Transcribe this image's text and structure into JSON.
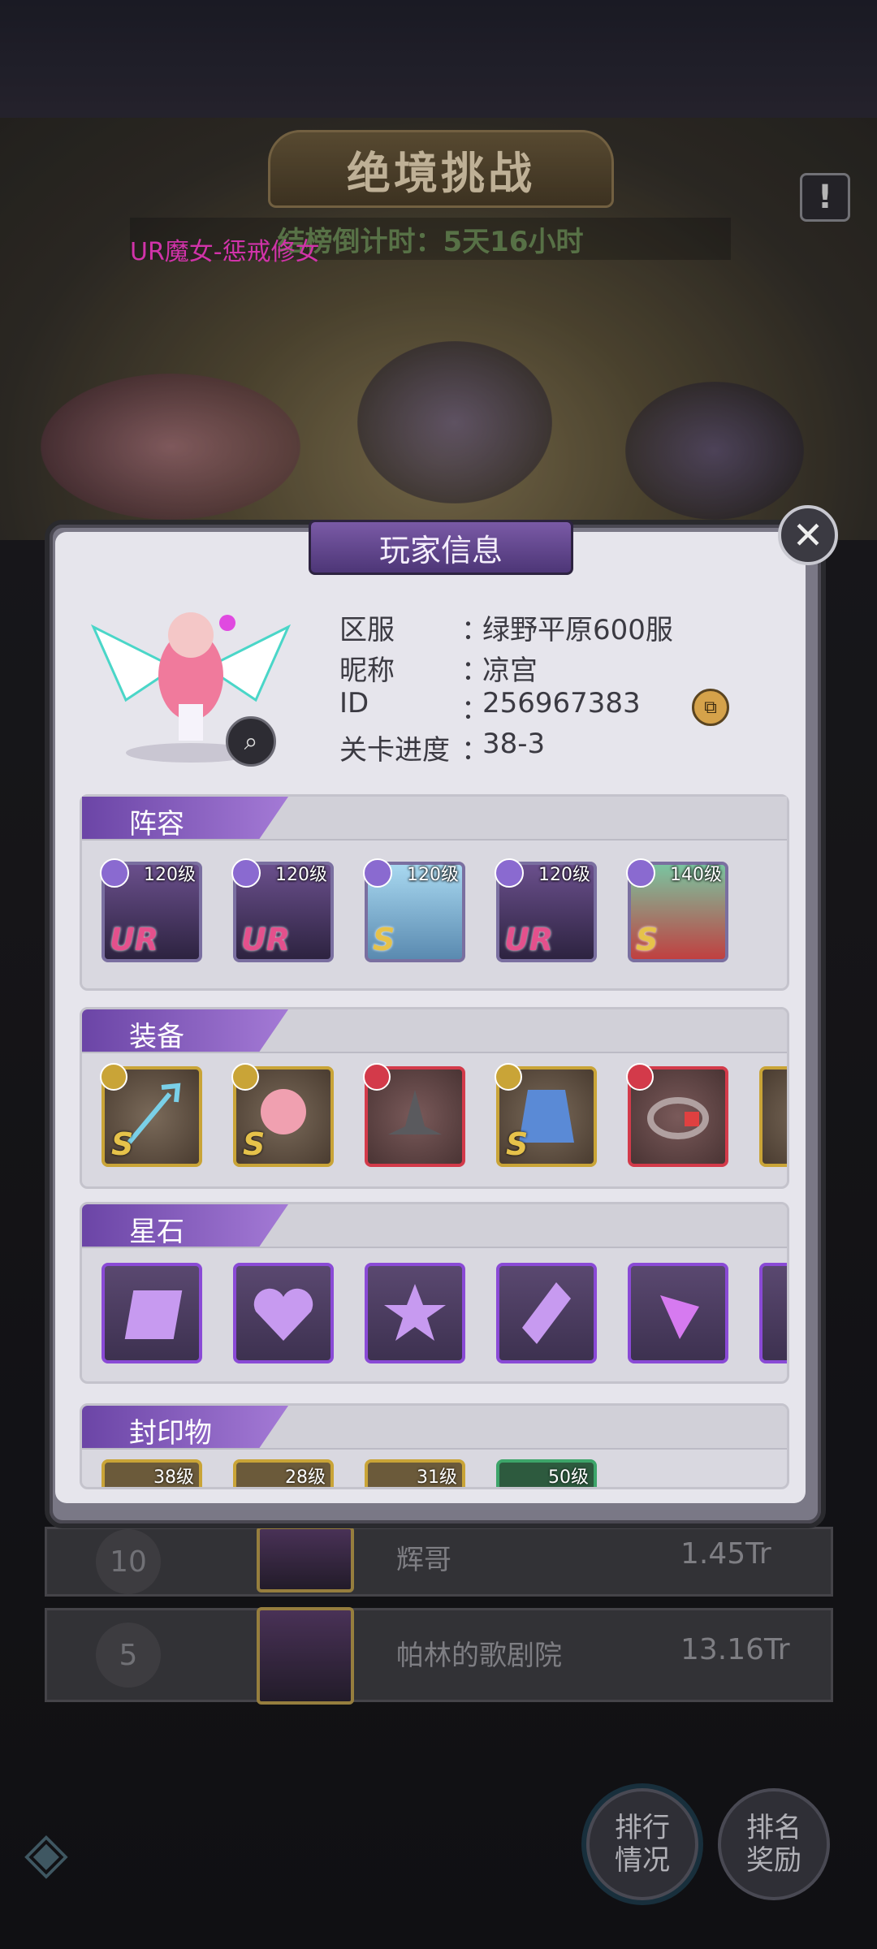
{
  "background": {
    "title": "绝境挑战",
    "countdown": "结榜倒计时：5天16小时",
    "scroll_message": "UR魔女-惩戒修女",
    "rank_rows": [
      {
        "rank": "10",
        "name": "辉哥",
        "score": "1.45Tr"
      },
      {
        "rank": "5",
        "name": "帕林的歌剧院",
        "score": "13.16Tr"
      }
    ],
    "buttons": {
      "rank_status": "排行\n情况",
      "rank_reward": "排名\n奖励"
    }
  },
  "dialog": {
    "title": "玩家信息",
    "info": {
      "server_label": "区服",
      "server_value": "绿野平原600服",
      "nickname_label": "昵称",
      "nickname_value": "凉宫",
      "id_label": "ID",
      "id_value": "256967383",
      "progress_label": "关卡进度",
      "progress_value": "38-3",
      "colon": "："
    },
    "sections": {
      "lineup": {
        "title": "阵容",
        "heroes": [
          {
            "level": "120级",
            "rank": "UR"
          },
          {
            "level": "120级",
            "rank": "UR"
          },
          {
            "level": "120级",
            "rank": "S"
          },
          {
            "level": "120级",
            "rank": "UR"
          },
          {
            "level": "140级",
            "rank": "S"
          }
        ]
      },
      "equipment": {
        "title": "装备",
        "items": [
          {
            "rank": "S",
            "icon": "trident-icon"
          },
          {
            "rank": "S",
            "icon": "lotus-orb-icon"
          },
          {
            "rank": "",
            "icon": "witch-hat-icon"
          },
          {
            "rank": "S",
            "icon": "robe-icon"
          },
          {
            "rank": "",
            "icon": "ring-icon"
          }
        ]
      },
      "star_stones": {
        "title": "星石"
      },
      "seals": {
        "title": "封印物",
        "items": [
          {
            "level": "38级"
          },
          {
            "level": "28级"
          },
          {
            "level": "31级"
          },
          {
            "level": "50级"
          }
        ]
      }
    }
  }
}
